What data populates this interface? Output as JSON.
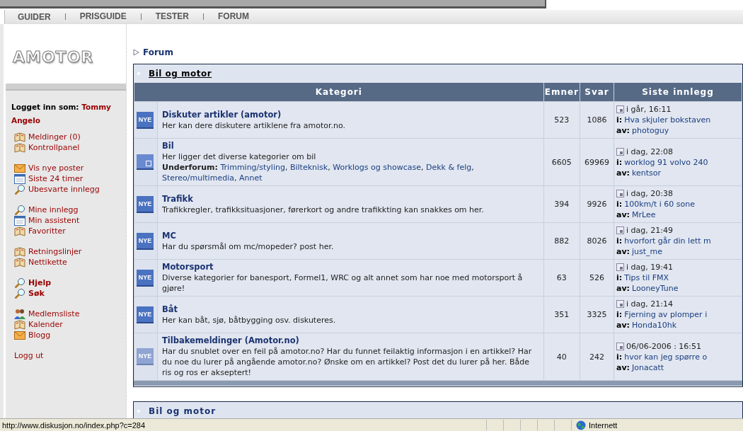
{
  "nav": [
    {
      "label": "GUIDER"
    },
    {
      "label": "PRISGUIDE"
    },
    {
      "label": "TESTER"
    },
    {
      "label": "FORUM"
    }
  ],
  "logo": "AMOTOR",
  "sidebar": {
    "login_label": "Logget inn som:",
    "username": "Tommy Angelo",
    "groups": [
      [
        {
          "label": "Meldinger (0)",
          "kind": "book",
          "bold": false
        },
        {
          "label": "Kontrollpanel",
          "kind": "book",
          "bold": false
        }
      ],
      [
        {
          "label": "Vis nye poster",
          "kind": "mail",
          "bold": false
        },
        {
          "label": "Siste 24 timer",
          "kind": "calendar",
          "bold": false
        },
        {
          "label": "Ubesvarte innlegg",
          "kind": "search",
          "bold": false
        }
      ],
      [
        {
          "label": "Mine innlegg",
          "kind": "search",
          "bold": false
        },
        {
          "label": "Min assistent",
          "kind": "calendar",
          "bold": false
        },
        {
          "label": "Favoritter",
          "kind": "book",
          "bold": false
        }
      ],
      [
        {
          "label": "Retningslinjer",
          "kind": "book",
          "bold": false
        },
        {
          "label": "Nettikette",
          "kind": "book",
          "bold": false
        }
      ],
      [
        {
          "label": "Hjelp",
          "kind": "search",
          "bold": true
        },
        {
          "label": "Søk",
          "kind": "search",
          "bold": true
        }
      ],
      [
        {
          "label": "Medlemsliste",
          "kind": "people",
          "bold": false
        },
        {
          "label": "Kalender",
          "kind": "book",
          "bold": false
        },
        {
          "label": "Blogg",
          "kind": "mail",
          "bold": false
        }
      ],
      [
        {
          "label": "Logg ut",
          "kind": "plain",
          "bold": false
        }
      ]
    ]
  },
  "breadcrumb": "Forum",
  "section": {
    "title": "Bil og motor",
    "columns": [
      "Kategori",
      "Emner",
      "Svar",
      "Siste innlegg"
    ],
    "rows": [
      {
        "kind": "new",
        "badge": "NYE",
        "title": "Diskuter artikler (amotor)",
        "description": "Her kan dere diskutere artiklene fra amotor.no.",
        "emner": "523",
        "svar": "1086",
        "last": {
          "date": "i går, 16:11",
          "topic_label": "i:",
          "topic": "Hva skjuler bokstaven",
          "author_label": "av:",
          "author": "photoguy"
        }
      },
      {
        "kind": "links",
        "title": "Bil",
        "description": "Her ligger det diverse kategorier om bil",
        "subforums": {
          "label": "Underforum:",
          "separator": ",",
          "links": [
            "Trimming/styling",
            "Bilteknisk",
            "Worklogs og showcase",
            "Dekk & felg",
            "Stereo/multimedia",
            "Annet"
          ]
        },
        "emner": "6605",
        "svar": "69969",
        "last": {
          "date": "i dag, 22:08",
          "topic_label": "i:",
          "topic": "worklog 91 volvo 240",
          "author_label": "av:",
          "author": "kentsor"
        }
      },
      {
        "kind": "new",
        "badge": "NYE",
        "title": "Trafikk",
        "description": "Trafikkregler, trafikksituasjoner, førerkort og andre trafikkting kan snakkes om her.",
        "emner": "394",
        "svar": "9926",
        "last": {
          "date": "i dag, 20:38",
          "topic_label": "i:",
          "topic": "100km/t i 60 sone",
          "author_label": "av:",
          "author": "MrLee"
        }
      },
      {
        "kind": "new",
        "badge": "NYE",
        "title": "MC",
        "description": "Har du spørsmål om mc/mopeder? post her.",
        "emner": "882",
        "svar": "8026",
        "last": {
          "date": "i dag, 21:49",
          "topic_label": "i:",
          "topic": "hvorfort går din lett m",
          "author_label": "av:",
          "author": "just_me"
        }
      },
      {
        "kind": "new",
        "badge": "NYE",
        "title": "Motorsport",
        "description": "Diverse kategorier for banesport, Formel1, WRC og alt annet som har noe med motorsport å gjøre!",
        "emner": "63",
        "svar": "526",
        "last": {
          "date": "i dag, 19:41",
          "topic_label": "i:",
          "topic": "Tips til FMX",
          "author_label": "av:",
          "author": "LooneyTune"
        }
      },
      {
        "kind": "new",
        "badge": "NYE",
        "title": "Båt",
        "description": "Her kan båt, sjø, båtbygging osv. diskuteres.",
        "emner": "351",
        "svar": "3325",
        "last": {
          "date": "i dag, 21:14",
          "topic_label": "i:",
          "topic": "Fjerning av plomper i",
          "author_label": "av:",
          "author": "Honda10hk"
        }
      },
      {
        "kind": "old",
        "badge": "NYE",
        "title": "Tilbakemeldinger (Amotor.no)",
        "description": "Har du snublet over en feil på amotor.no? Har du funnet feilaktig informasjon i en artikkel? Har du noe du lurer på angående amotor.no? Ønske om en artikkel? Post det du lurer på her. Både ris og ros er akseptert!",
        "emner": "40",
        "svar": "242",
        "last": {
          "date": "06/06-2006 : 16:51",
          "topic_label": "i:",
          "topic": "hvor kan jeg spørre o",
          "author_label": "av:",
          "author": "Jonacatt"
        }
      }
    ]
  },
  "next_section": {
    "title": "Bil og motor"
  },
  "status_bar": {
    "url": "http://www.diskusjon.no/index.php?c=284",
    "zone": "Internett"
  }
}
